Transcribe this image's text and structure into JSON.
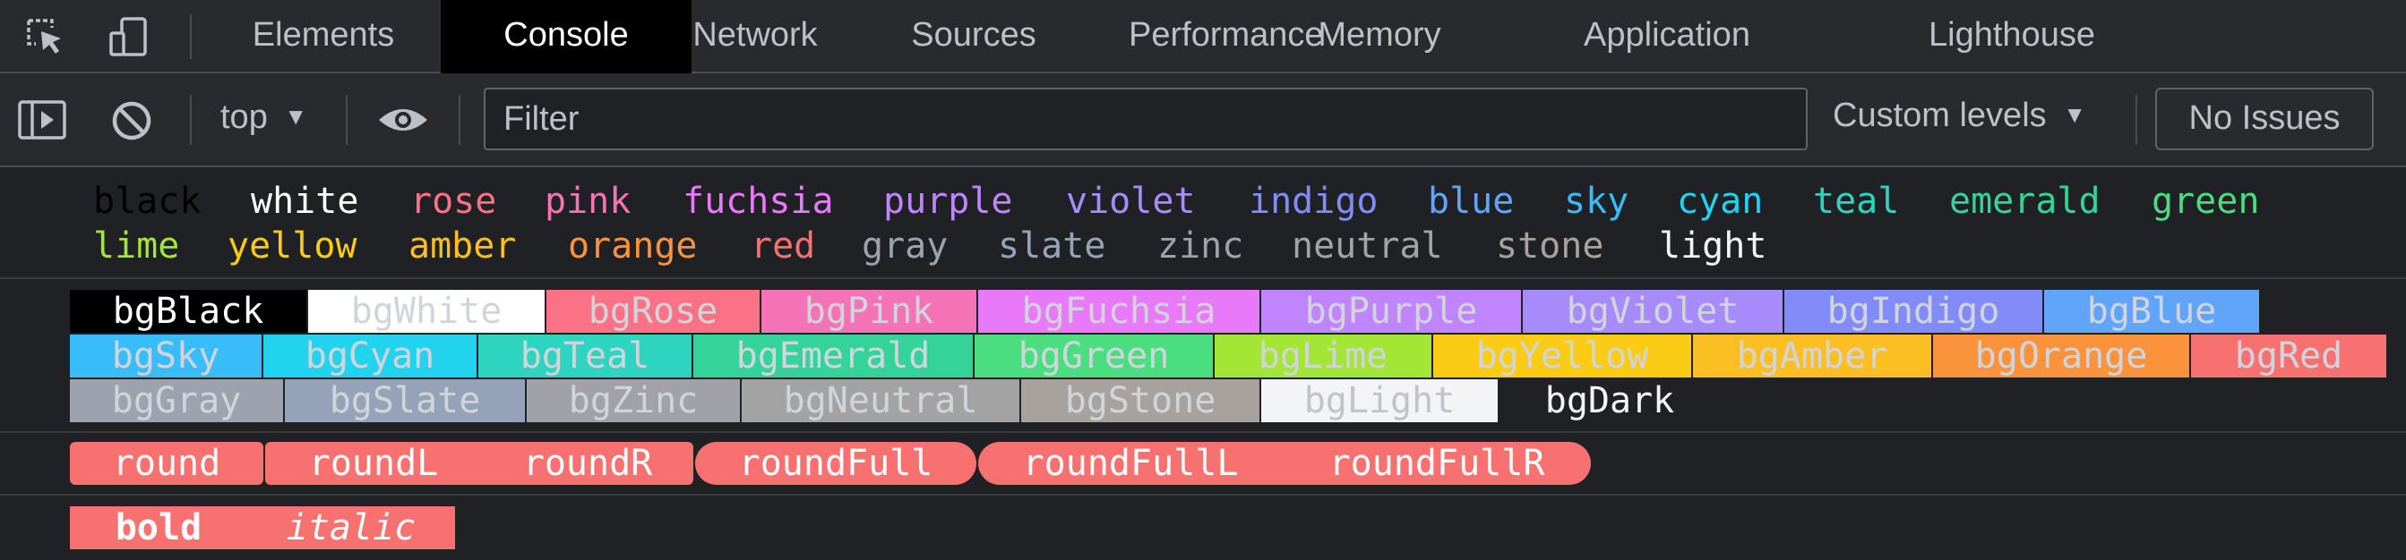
{
  "tabs": [
    "Elements",
    "Console",
    "Network",
    "Sources",
    "Performance",
    "Memory",
    "Application",
    "Lighthouse"
  ],
  "active_tab": "Console",
  "toolbar": {
    "context": "top",
    "filter_placeholder": "Filter",
    "levels": "Custom levels",
    "issues": "No Issues"
  },
  "colors_row1": [
    {
      "text": "black",
      "color": "#000000"
    },
    {
      "text": "white",
      "color": "#ffffff"
    },
    {
      "text": "rose",
      "color": "#fb7185"
    },
    {
      "text": "pink",
      "color": "#f472b6"
    },
    {
      "text": "fuchsia",
      "color": "#e879f9"
    },
    {
      "text": "purple",
      "color": "#c084fc"
    },
    {
      "text": "violet",
      "color": "#a78bfa"
    },
    {
      "text": "indigo",
      "color": "#818cf8"
    },
    {
      "text": "blue",
      "color": "#60a5fa"
    },
    {
      "text": "sky",
      "color": "#38bdf8"
    },
    {
      "text": "cyan",
      "color": "#22d3ee"
    },
    {
      "text": "teal",
      "color": "#2dd4bf"
    },
    {
      "text": "emerald",
      "color": "#34d399"
    },
    {
      "text": "green",
      "color": "#4ade80"
    }
  ],
  "colors_row2": [
    {
      "text": "lime",
      "color": "#a3e635"
    },
    {
      "text": "yellow",
      "color": "#facc15"
    },
    {
      "text": "amber",
      "color": "#fbbf24"
    },
    {
      "text": "orange",
      "color": "#fb923c"
    },
    {
      "text": "red",
      "color": "#f87171"
    },
    {
      "text": "gray",
      "color": "#9ca3af"
    },
    {
      "text": "slate",
      "color": "#94a3b8"
    },
    {
      "text": "zinc",
      "color": "#a1a1aa"
    },
    {
      "text": "neutral",
      "color": "#a3a3a3"
    },
    {
      "text": "stone",
      "color": "#a8a29e"
    },
    {
      "text": "light",
      "color": "#f3f4f6"
    }
  ],
  "bg_row1": [
    {
      "text": "bgBlack",
      "bg": "#000000",
      "fg": "#ffffff"
    },
    {
      "text": "bgWhite",
      "bg": "#ffffff",
      "fg": "#d1d5db"
    },
    {
      "text": "bgRose",
      "bg": "#fb7185",
      "fg": "#d1d5db"
    },
    {
      "text": "bgPink",
      "bg": "#f472b6",
      "fg": "#d1d5db"
    },
    {
      "text": "bgFuchsia",
      "bg": "#e879f9",
      "fg": "#d1d5db"
    },
    {
      "text": "bgPurple",
      "bg": "#c084fc",
      "fg": "#d1d5db"
    },
    {
      "text": "bgViolet",
      "bg": "#a78bfa",
      "fg": "#d1d5db"
    },
    {
      "text": "bgIndigo",
      "bg": "#818cf8",
      "fg": "#d1d5db"
    },
    {
      "text": "bgBlue",
      "bg": "#60a5fa",
      "fg": "#d1d5db"
    }
  ],
  "bg_row2": [
    {
      "text": "bgSky",
      "bg": "#38bdf8",
      "fg": "#d1d5db"
    },
    {
      "text": "bgCyan",
      "bg": "#22d3ee",
      "fg": "#d1d5db"
    },
    {
      "text": "bgTeal",
      "bg": "#2dd4bf",
      "fg": "#d1d5db"
    },
    {
      "text": "bgEmerald",
      "bg": "#34d399",
      "fg": "#d1d5db"
    },
    {
      "text": "bgGreen",
      "bg": "#4ade80",
      "fg": "#d1d5db"
    },
    {
      "text": "bgLime",
      "bg": "#a3e635",
      "fg": "#d1d5db"
    },
    {
      "text": "bgYellow",
      "bg": "#facc15",
      "fg": "#d1d5db"
    },
    {
      "text": "bgAmber",
      "bg": "#fbbf24",
      "fg": "#d1d5db"
    },
    {
      "text": "bgOrange",
      "bg": "#fb923c",
      "fg": "#d1d5db"
    },
    {
      "text": "bgRed",
      "bg": "#f87171",
      "fg": "#d1d5db"
    }
  ],
  "bg_row3": [
    {
      "text": "bgGray",
      "bg": "#9ca3af",
      "fg": "#d1d5db"
    },
    {
      "text": "bgSlate",
      "bg": "#94a3b8",
      "fg": "#d1d5db"
    },
    {
      "text": "bgZinc",
      "bg": "#a1a1aa",
      "fg": "#d1d5db"
    },
    {
      "text": "bgNeutral",
      "bg": "#a3a3a3",
      "fg": "#d1d5db"
    },
    {
      "text": "bgStone",
      "bg": "#a8a29e",
      "fg": "#d1d5db"
    },
    {
      "text": "bgLight",
      "bg": "#f3f4f6",
      "fg": "#c0c4c9"
    },
    {
      "text": "bgDark",
      "bg": "#202124",
      "fg": "#f3f4f6"
    }
  ],
  "round_chips": [
    "round",
    "roundL",
    "roundR",
    "roundFull",
    "roundFullL",
    "roundFullR"
  ],
  "round_color": "#f87171",
  "style_chips": [
    "bold",
    "italic"
  ]
}
